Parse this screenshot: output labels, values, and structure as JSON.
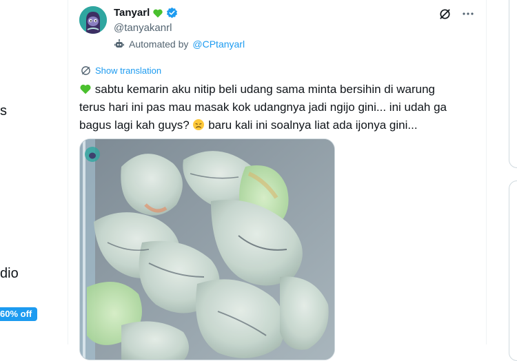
{
  "left_nav": {
    "fragment_1": "s",
    "fragment_2": "dio",
    "promo_badge": "60% off"
  },
  "tweet": {
    "display_name": "Tanyarl",
    "handle": "@tanyakanrl",
    "automated_prefix": "Automated by",
    "automated_link": "@CPtanyarl",
    "show_translation": "Show translation",
    "text_line1": "sabtu kemarin aku nitip beli udang sama minta bersihin di warung",
    "text_line2": "terus hari ini pas mau masak kok udangnya jadi ngijo gini... ini udah ga",
    "text_line3a": "bagus lagi kah guys?",
    "text_line3b": "baru kali ini soalnya liat ada ijonya gini...",
    "image_subject": "shrimp in plastic container"
  },
  "colors": {
    "accent": "#1d9bf0",
    "heart_green": "#4ac02e",
    "text_primary": "#0f1419",
    "text_secondary": "#536471"
  },
  "icons": [
    "heart-icon",
    "verified-badge-icon",
    "robot-icon",
    "grok-icon",
    "more-icon",
    "translate-icon",
    "sad-face-emoji"
  ]
}
